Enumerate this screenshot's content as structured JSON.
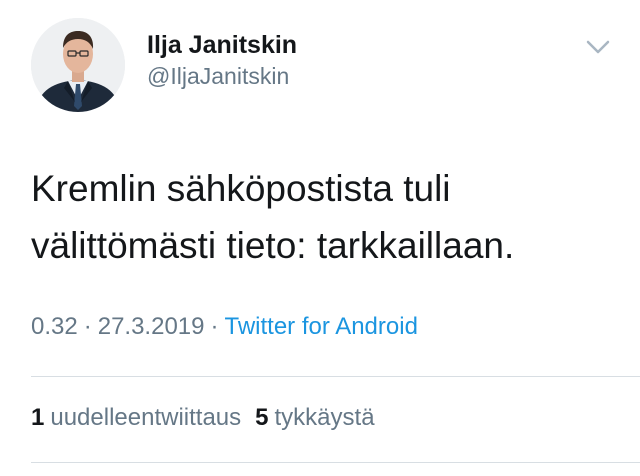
{
  "author": {
    "name": "Ilja Janitskin",
    "handle": "@IljaJanitskin",
    "avatar_icon": "profile-photo"
  },
  "menu_icon": "chevron-down-icon",
  "tweet": {
    "line1": "Kremlin sähköpostista tuli",
    "line2": "välittömästi tieto: tarkkaillaan."
  },
  "meta": {
    "time": "0.32",
    "date": "27.3.2019",
    "separator": "·",
    "source": "Twitter for Android"
  },
  "stats": {
    "retweets_count": "1",
    "retweets_label": "uudelleentwiittaus",
    "likes_count": "5",
    "likes_label": "tykkäystä"
  },
  "colors": {
    "text": "#14171a",
    "secondary": "#657786",
    "link": "#1b95e0",
    "divider": "#d8dee3"
  }
}
